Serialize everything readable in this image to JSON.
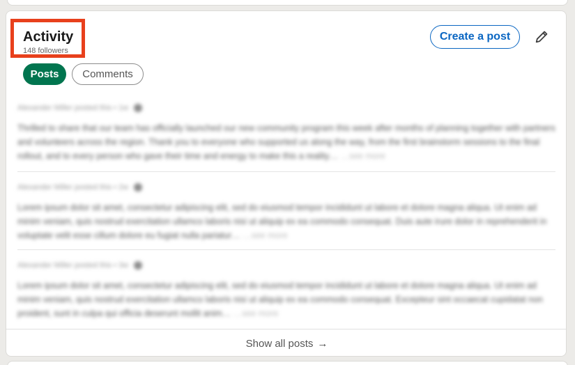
{
  "activity": {
    "title": "Activity",
    "followers": "148 followers",
    "create_post_label": "Create a post",
    "edit_icon": "pencil-icon"
  },
  "filters": [
    {
      "label": "Posts",
      "active": true
    },
    {
      "label": "Comments",
      "active": false
    }
  ],
  "posts": [
    {
      "meta": "Alexander Miller posted this • 1w",
      "text": "Thrilled to share that our team has officially launched our new community program this week after months of planning together with partners and volunteers across the region. Thank you to everyone who supported us along the way, from the first brainstorm sessions to the final rollout, and to every person who gave their time and energy to make this a reality…",
      "more": "…see more"
    },
    {
      "meta": "Alexander Miller posted this • 2w",
      "text": "Lorem ipsum dolor sit amet, consectetur adipiscing elit, sed do eiusmod tempor incididunt ut labore et dolore magna aliqua. Ut enim ad minim veniam, quis nostrud exercitation ullamco laboris nisi ut aliquip ex ea commodo consequat. Duis aute irure dolor in reprehenderit in voluptate velit esse cillum dolore eu fugiat nulla pariatur…",
      "more": "…see more"
    },
    {
      "meta": "Alexander Miller posted this • 3w",
      "text": "Lorem ipsum dolor sit amet, consectetur adipiscing elit, sed do eiusmod tempor incididunt ut labore et dolore magna aliqua. Ut enim ad minim veniam, quis nostrud exercitation ullamco laboris nisi ut aliquip ex ea commodo consequat. Excepteur sint occaecat cupidatat non proident, sunt in culpa qui officia deserunt mollit anim…",
      "more": "…see more"
    }
  ],
  "footer": {
    "show_all_label": "Show all posts",
    "arrow": "→"
  },
  "colors": {
    "primary_blue": "#0a66c2",
    "active_chip_green": "#01754f",
    "highlight_red": "#e8401c"
  }
}
